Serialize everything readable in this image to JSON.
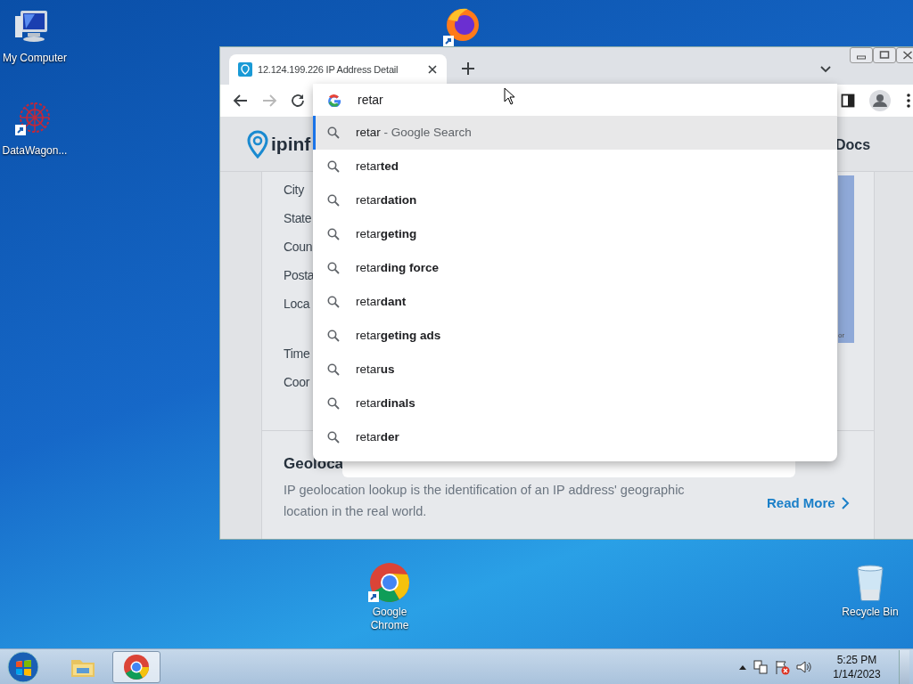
{
  "desktop_icons": [
    {
      "kind": "computer",
      "label": "My Computer"
    },
    {
      "kind": "wagon",
      "label": "DataWagon..."
    },
    {
      "kind": "firefox"
    },
    {
      "kind": "chrome",
      "label": "Google Chrome"
    },
    {
      "kind": "recycle",
      "label": "Recycle Bin"
    }
  ],
  "browser": {
    "tabs": [
      {
        "title": "12.124.199.226 IP Address Detail",
        "selected": true
      }
    ],
    "toolbar": {
      "forward_disabled": true
    },
    "omnibox": {
      "value": "retar"
    },
    "suggestions": [
      {
        "kind": "search",
        "text": "retar",
        "suffix": " - Google Search",
        "selected": true
      },
      {
        "kind": "query",
        "text": "retar**ted**",
        "selected": false
      },
      {
        "kind": "query",
        "text": "retar**dation**",
        "selected": false
      },
      {
        "kind": "query",
        "text": "retar**geting**",
        "selected": false
      },
      {
        "kind": "query",
        "text": "retar**ding force**",
        "selected": false
      },
      {
        "kind": "query",
        "text": "retar**dant**",
        "selected": false
      },
      {
        "kind": "query",
        "text": "retar**geting ads**",
        "selected": false
      },
      {
        "kind": "query",
        "text": "retar**us**",
        "selected": false
      },
      {
        "kind": "query",
        "text": "retar**dinals**",
        "selected": false
      },
      {
        "kind": "query",
        "text": "retar**der**",
        "selected": false
      }
    ],
    "page": {
      "logo": "ipinf",
      "nav_link": "Docs",
      "field_labels": [
        "City",
        "State",
        "Coun",
        "Posta",
        "Loca",
        "Time",
        "Coor"
      ],
      "map_caption": "or",
      "section_title": "Geoloca",
      "section_text": "IP geolocation lookup is the identification of an IP address' geographic location in the real world.",
      "read_more": "Read More"
    }
  },
  "taskbar": {
    "apps": [
      {
        "kind": "explorer",
        "active": false
      },
      {
        "kind": "chrome",
        "active": true
      }
    ],
    "time": "5:25 PM",
    "date": "1/14/2023"
  }
}
